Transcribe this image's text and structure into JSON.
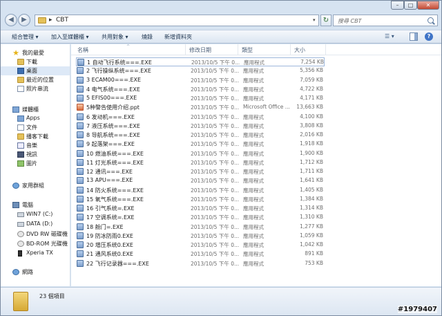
{
  "window": {
    "min_icon": "minimize-icon",
    "max_icon": "maximize-icon",
    "close_glyph": "✕",
    "min_glyph": "–",
    "max_glyph": "□"
  },
  "address": {
    "crumb": "CBT",
    "search_placeholder": "搜尋 CBT"
  },
  "toolbar": {
    "organize": "組合管理 ▾",
    "add_library": "加入至媒體櫃 ▾",
    "share": "共用對象 ▾",
    "burn": "燒錄",
    "new_folder": "新增資料夾"
  },
  "nav": {
    "favorites": "我的最愛",
    "downloads": "下載",
    "desktop": "桌面",
    "recent": "最近的位置",
    "photostream": "照片串流",
    "libraries": "媒體櫃",
    "apps": "Apps",
    "documents": "文件",
    "podcasts": "播客下載",
    "music": "音樂",
    "videos": "視訊",
    "pictures": "圖片",
    "homegroup": "家用群組",
    "computer": "電腦",
    "drive_c": "WIN7 (C:)",
    "drive_d": "DATA (D:)",
    "dvd": "DVD RW 磁碟機 (",
    "bd": "BD-ROM 光碟機 (",
    "phone": "Xperia TX",
    "network": "網路"
  },
  "columns": {
    "name": "名稱",
    "date": "修改日期",
    "type": "類型",
    "size": "大小"
  },
  "files": [
    {
      "name": "1 自动飞行系统===.EXE",
      "date": "2013/10/5 下午 0...",
      "type": "應用程式",
      "size": "7,254 KB",
      "kind": "exe"
    },
    {
      "name": "2 飞行操纵系统===.EXE",
      "date": "2013/10/5 下午 0...",
      "type": "應用程式",
      "size": "5,356 KB",
      "kind": "exe"
    },
    {
      "name": "3 ECAM00===.EXE",
      "date": "2013/10/5 下午 0...",
      "type": "應用程式",
      "size": "7,059 KB",
      "kind": "exe"
    },
    {
      "name": "4 电气系统===.EXE",
      "date": "2013/10/5 下午 0...",
      "type": "應用程式",
      "size": "4,722 KB",
      "kind": "exe"
    },
    {
      "name": "5 EFIS00===.EXE",
      "date": "2013/10/5 下午 0...",
      "type": "應用程式",
      "size": "4,171 KB",
      "kind": "exe"
    },
    {
      "name": "5种警告使用介绍.ppt",
      "date": "2013/10/5 下午 0...",
      "type": "Microsoft Office ...",
      "size": "13,663 KB",
      "kind": "ppt"
    },
    {
      "name": "6 发动机===.EXE",
      "date": "2013/10/5 下午 0...",
      "type": "應用程式",
      "size": "4,100 KB",
      "kind": "exe"
    },
    {
      "name": "7 液压系统===.EXE",
      "date": "2013/10/5 下午 0...",
      "type": "應用程式",
      "size": "3,808 KB",
      "kind": "exe"
    },
    {
      "name": "8 导航系统===.EXE",
      "date": "2013/10/5 下午 0...",
      "type": "應用程式",
      "size": "2,016 KB",
      "kind": "exe"
    },
    {
      "name": "9 起落架===.EXE",
      "date": "2013/10/5 下午 0...",
      "type": "應用程式",
      "size": "1,918 KB",
      "kind": "exe"
    },
    {
      "name": "10 燃油系统===.EXE",
      "date": "2013/10/5 下午 0...",
      "type": "應用程式",
      "size": "1,900 KB",
      "kind": "exe"
    },
    {
      "name": "11 灯光系统===.EXE",
      "date": "2013/10/5 下午 0...",
      "type": "應用程式",
      "size": "1,712 KB",
      "kind": "exe"
    },
    {
      "name": "12 通讯===.EXE",
      "date": "2013/10/5 下午 0...",
      "type": "應用程式",
      "size": "1,711 KB",
      "kind": "exe"
    },
    {
      "name": "13 APU===.EXE",
      "date": "2013/10/5 下午 0...",
      "type": "應用程式",
      "size": "1,641 KB",
      "kind": "exe"
    },
    {
      "name": "14 防火系统===.EXE",
      "date": "2013/10/5 下午 0...",
      "type": "應用程式",
      "size": "1,405 KB",
      "kind": "exe"
    },
    {
      "name": "15 氧气系统===.EXE",
      "date": "2013/10/5 下午 0...",
      "type": "應用程式",
      "size": "1,384 KB",
      "kind": "exe"
    },
    {
      "name": "16 引气系统=.EXE",
      "date": "2013/10/5 下午 0...",
      "type": "應用程式",
      "size": "1,314 KB",
      "kind": "exe"
    },
    {
      "name": "17 空调系统=.EXE",
      "date": "2013/10/5 下午 0...",
      "type": "應用程式",
      "size": "1,310 KB",
      "kind": "exe"
    },
    {
      "name": "18 舱门=.EXE",
      "date": "2013/10/5 下午 0...",
      "type": "應用程式",
      "size": "1,277 KB",
      "kind": "exe"
    },
    {
      "name": "19 防冰防雨0.EXE",
      "date": "2013/10/5 下午 0...",
      "type": "應用程式",
      "size": "1,059 KB",
      "kind": "exe"
    },
    {
      "name": "20 增压系统0.EXE",
      "date": "2013/10/5 下午 0...",
      "type": "應用程式",
      "size": "1,042 KB",
      "kind": "exe"
    },
    {
      "name": "21 通风系统0.EXE",
      "date": "2013/10/5 下午 0...",
      "type": "應用程式",
      "size": "891 KB",
      "kind": "exe"
    },
    {
      "name": "22 飞行记录器===.EXE",
      "date": "2013/10/5 下午 0...",
      "type": "應用程式",
      "size": "753 KB",
      "kind": "exe"
    }
  ],
  "status": {
    "count": "23 個項目"
  },
  "watermark": "#1979407"
}
